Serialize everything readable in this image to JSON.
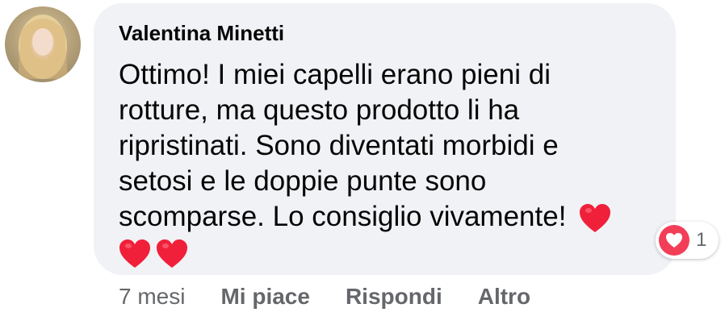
{
  "comment": {
    "author": "Valentina Minetti",
    "lines": [
      "Ottimo! I miei capelli erano pieni di",
      "rotture, ma questo prodotto li ha",
      "ripristinati. Sono diventati morbidi e",
      "setosi e le doppie punte sono",
      "scomparse. Lo consiglio vivamente!"
    ],
    "emoji_icon": "red-heart-icon",
    "bubble_color": "#f0f2f5"
  },
  "reactions": {
    "icon": "love-reaction-icon",
    "count": "1",
    "color": "#f33e58"
  },
  "footer": {
    "time": "7 mesi",
    "like_label": "Mi piace",
    "reply_label": "Rispondi",
    "more_label": "Altro"
  }
}
